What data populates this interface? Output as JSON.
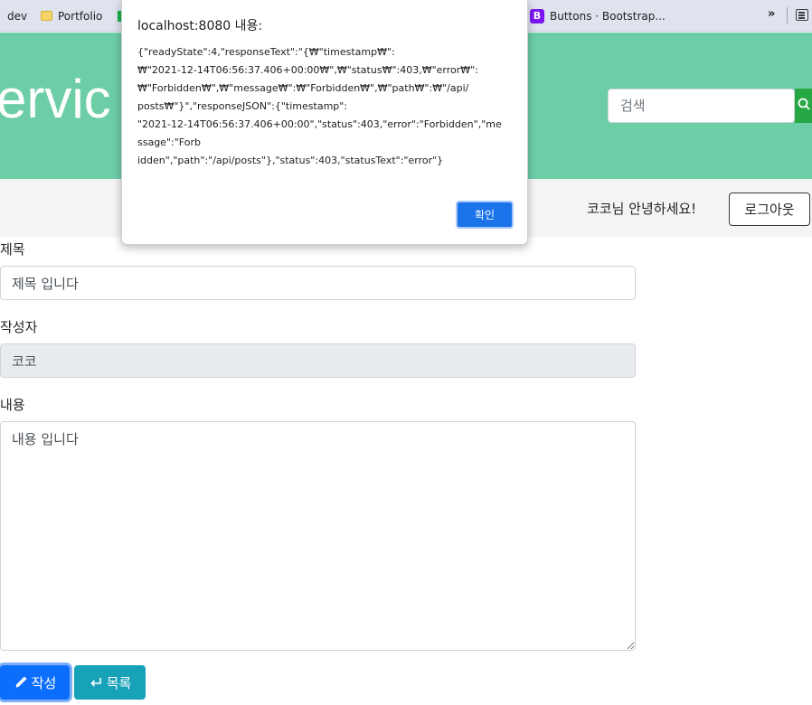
{
  "bookmarks": [
    {
      "label": "dev",
      "icon": "none"
    },
    {
      "label": "Portfolio",
      "icon": "folder-icon"
    },
    {
      "label": "",
      "icon": "green-bookmark-icon"
    },
    {
      "label": "Buttons · Bootstrap...",
      "icon": "bootstrap-icon",
      "icon_text": "B"
    }
  ],
  "bookmarks_more": "»",
  "header": {
    "title": "ervic",
    "search_placeholder": "검색",
    "search_button_icon": "search-icon",
    "bg_color": "#6ccda7"
  },
  "navbar": {
    "greeting": "코코님 안녕하세요!",
    "logout_label": "로그아웃"
  },
  "form": {
    "title_label": "제목",
    "title_value": "제목 입니다",
    "author_label": "작성자",
    "author_value": "코코",
    "content_label": "내용",
    "content_value": "내용 입니다",
    "write_button": "작성",
    "write_icon": "pencil-icon",
    "list_button": "목록",
    "list_icon": "return-arrow-icon"
  },
  "dialog": {
    "title": "localhost:8080 내용:",
    "message": "{\"readyState\":4,\"responseText\":\"{₩\"timestamp₩\":\n₩\"2021-12-14T06:56:37.406+00:00₩\",₩\"status₩\":403,₩\"error₩\":\n₩\"Forbidden₩\",₩\"message₩\":₩\"Forbidden₩\",₩\"path₩\":₩\"/api/\nposts₩\"}\",\"responseJSON\":{\"timestamp\":\n\"2021-12-14T06:56:37.406+00:00\",\"status\":403,\"error\":\"Forbidden\",\"me\nssage\":\"Forb\nidden\",\"path\":\"/api/posts\"},\"status\":403,\"statusText\":\"error\"}",
    "ok_label": "확인",
    "ok_color": "#1a73e8"
  }
}
